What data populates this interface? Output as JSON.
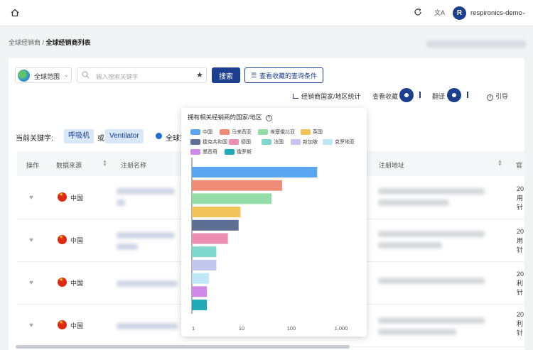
{
  "topbar": {
    "username": "respironics-demo",
    "avatar_letter": "R"
  },
  "breadcrumb": {
    "parent": "全球经销商",
    "separator": " / ",
    "current": "全球经销商列表"
  },
  "search": {
    "scope_label": "全球范围",
    "placeholder": "输入搜索关键字",
    "search_button": "搜索",
    "saved_button": "查看收藏的查询条件"
  },
  "options": {
    "stats_label": "经销商国家/地区统计",
    "view_saved_label": "查看收藏",
    "translate_label": "翻译",
    "guide_label": "引导"
  },
  "keywords": {
    "prefix": "当前关键字:",
    "tag1": "呼吸机",
    "or": "或",
    "tag2": "Ventilator",
    "scope": "全球范围"
  },
  "table": {
    "headers": {
      "op": "操作",
      "source": "数据来源",
      "name": "注册名称",
      "address": "注册地址",
      "last": "官"
    },
    "rows": [
      {
        "country": "中国",
        "trail": [
          "20",
          "用",
          "针"
        ]
      },
      {
        "country": "中国",
        "trail": [
          "20",
          "用",
          "针"
        ]
      },
      {
        "country": "中国",
        "trail": [
          "20",
          "利",
          "针"
        ]
      },
      {
        "country": "中国",
        "trail": [
          "20",
          "利",
          "针"
        ]
      }
    ]
  },
  "colors": {
    "primary": "#1c3f8f",
    "tag_bg": "#d9e8f9"
  },
  "popup": {
    "title": "拥有相关经销商的国家/地区"
  },
  "chart_data": {
    "type": "bar",
    "orientation": "horizontal",
    "x_scale": "log",
    "xlim": [
      1,
      1000
    ],
    "x_ticks": [
      "1",
      "10",
      "100",
      "1,000"
    ],
    "title": "拥有相关经销商的国家/地区",
    "legend_position": "top",
    "series": [
      {
        "name": "中国",
        "value": 330,
        "color": "#5aa6f0"
      },
      {
        "name": "马来西亚",
        "value": 65,
        "color": "#ef8c78"
      },
      {
        "name": "埃塞俄比亚",
        "value": 40,
        "color": "#94dca6"
      },
      {
        "name": "英国",
        "value": 9.5,
        "color": "#f0c45a"
      },
      {
        "name": "捷克共和国",
        "value": 8.7,
        "color": "#5e6f95"
      },
      {
        "name": "德国",
        "value": 5.3,
        "color": "#ec8fb2"
      },
      {
        "name": "法国",
        "value": 3.1,
        "color": "#7fd7ce"
      },
      {
        "name": "新加坡",
        "value": 3.1,
        "color": "#c3c6ef"
      },
      {
        "name": "克罗地亚",
        "value": 2.2,
        "color": "#bfe8f6"
      },
      {
        "name": "墨西哥",
        "value": 2.0,
        "color": "#d08be8"
      },
      {
        "name": "俄罗斯",
        "value": 2.0,
        "color": "#22a9b8"
      }
    ]
  }
}
